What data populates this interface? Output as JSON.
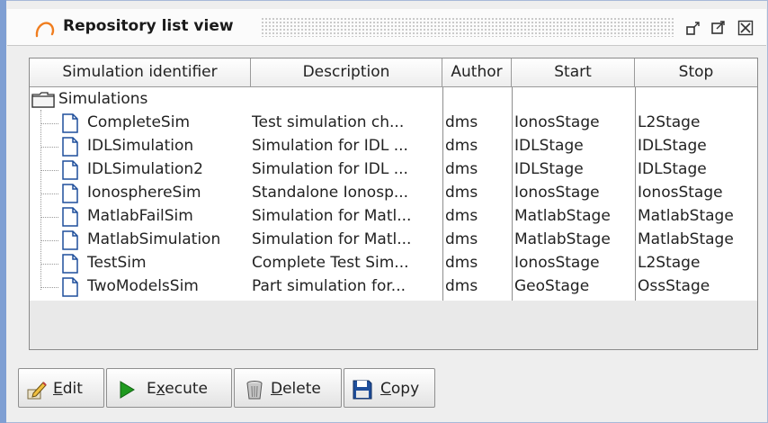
{
  "window": {
    "title": "Repository list view",
    "icons": {
      "logo": "spiral-logo-icon",
      "minimize": "minimize-icon",
      "maximize": "maximize-icon",
      "close": "close-icon"
    }
  },
  "table": {
    "columns": [
      {
        "label": "Simulation identifier"
      },
      {
        "label": "Description"
      },
      {
        "label": "Author"
      },
      {
        "label": "Start"
      },
      {
        "label": "Stop"
      }
    ],
    "root": {
      "label": "Simulations",
      "icon": "folder-icon"
    },
    "rows": [
      {
        "id": "CompleteSim",
        "description": "Test simulation ch...",
        "author": "dms",
        "start": "IonosStage",
        "stop": "L2Stage"
      },
      {
        "id": "IDLSimulation",
        "description": "Simulation for IDL ...",
        "author": "dms",
        "start": "IDLStage",
        "stop": "IDLStage"
      },
      {
        "id": "IDLSimulation2",
        "description": "Simulation for IDL ...",
        "author": "dms",
        "start": "IDLStage",
        "stop": "IDLStage"
      },
      {
        "id": "IonosphereSim",
        "description": "Standalone Ionosp...",
        "author": "dms",
        "start": "IonosStage",
        "stop": "IonosStage"
      },
      {
        "id": "MatlabFailSim",
        "description": "Simulation for Matl...",
        "author": "dms",
        "start": "MatlabStage",
        "stop": "MatlabStage"
      },
      {
        "id": "MatlabSimulation",
        "description": "Simulation for Matl...",
        "author": "dms",
        "start": "MatlabStage",
        "stop": "MatlabStage"
      },
      {
        "id": "TestSim",
        "description": "Complete Test Sim...",
        "author": "dms",
        "start": "IonosStage",
        "stop": "L2Stage"
      },
      {
        "id": "TwoModelsSim",
        "description": "Part simulation for...",
        "author": "dms",
        "start": "GeoStage",
        "stop": "OssStage"
      }
    ]
  },
  "toolbar": {
    "edit": {
      "mnemonic": "E",
      "rest": "dit",
      "icon": "edit-pencil-icon"
    },
    "execute": {
      "pre": "E",
      "mnemonic": "x",
      "rest": "ecute",
      "icon": "play-icon"
    },
    "delete": {
      "mnemonic": "D",
      "rest": "elete",
      "icon": "trash-can-icon"
    },
    "copy": {
      "mnemonic": "C",
      "rest": "opy",
      "icon": "floppy-disk-icon"
    }
  },
  "colors": {
    "accent": "#7f9fd3",
    "play_green": "#1f9a1f",
    "icon_blue": "#1f4f9c"
  }
}
